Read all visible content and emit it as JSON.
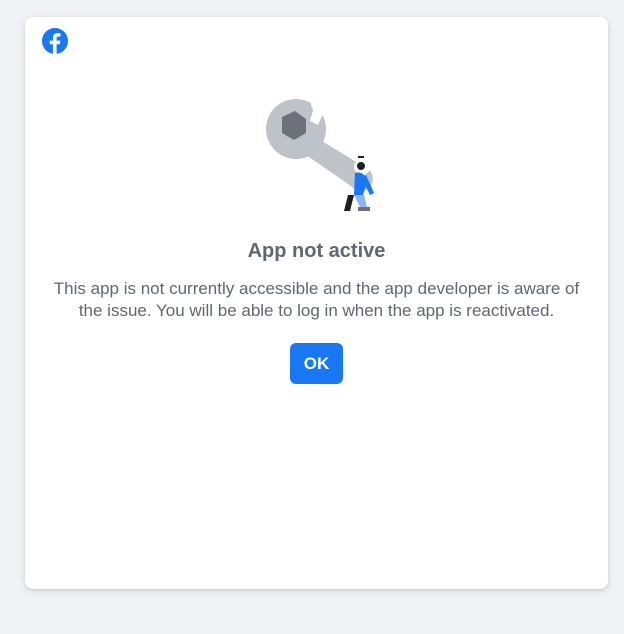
{
  "brand": {
    "logo_icon": "facebook-logo-icon",
    "color": "#1877f2"
  },
  "dialog": {
    "illustration_icon": "wrench-maintenance-illustration",
    "title": "App not active",
    "message": "This app is not currently accessible and the app developer is aware of the issue. You will be able to log in when the app is reactivated.",
    "ok_label": "OK"
  },
  "colors": {
    "page_background": "#f0f2f5",
    "card_background": "#ffffff",
    "text": "#606770",
    "button": "#1877f2",
    "button_text": "#ffffff"
  }
}
